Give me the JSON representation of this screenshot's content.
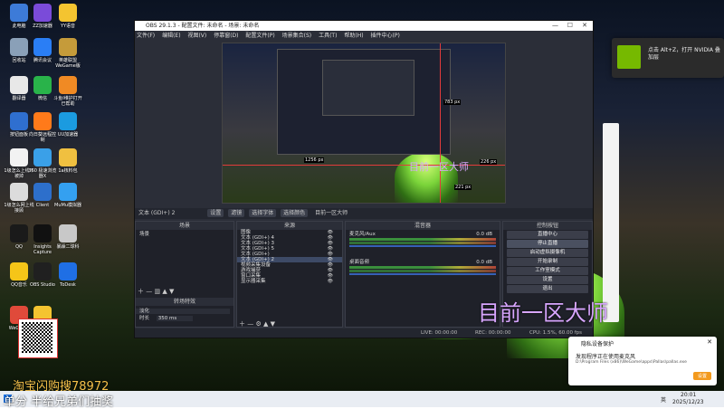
{
  "desktop_icons": [
    {
      "label": "此电脑",
      "color": "#3d7bd8"
    },
    {
      "label": "ZZ加速器",
      "color": "#7a4bd9"
    },
    {
      "label": "YY语音",
      "color": "#f4c430"
    },
    {
      "label": "回收站",
      "color": "#8aa0b8"
    },
    {
      "label": "腾讯会议",
      "color": "#2a7ef5"
    },
    {
      "label": "英雄联盟WeGame版",
      "color": "#c59b3a"
    },
    {
      "label": "翻译器",
      "color": "#e8e8e8"
    },
    {
      "label": "微信",
      "color": "#29b34a"
    },
    {
      "label": "斗鱼Ⅰ维护打开已帮助",
      "color": "#f08a24"
    },
    {
      "label": "按钮面板",
      "color": "#2f6fd0"
    },
    {
      "label": "向日葵远程控制",
      "color": "#ff7a1a"
    },
    {
      "label": "UU加速器",
      "color": "#1b9be0"
    },
    {
      "label": "1级怎么上线不被掉",
      "color": "#f2f2f2"
    },
    {
      "label": "360 极速浏览器X",
      "color": "#3aa0e8"
    },
    {
      "label": "1a核料包",
      "color": "#f0c040"
    },
    {
      "label": "1级怎么网上线接顾",
      "color": "#dcdcdc"
    },
    {
      "label": "Client",
      "color": "#2d6fcb"
    },
    {
      "label": "MuMu模拟器",
      "color": "#34a0f0"
    },
    {
      "label": "QQ",
      "color": "#1a1a1a"
    },
    {
      "label": "Insights Capture",
      "color": "#111111"
    },
    {
      "label": "暴躁二球科",
      "color": "#c8c8c8"
    },
    {
      "label": "QQ音乐",
      "color": "#f5c518"
    },
    {
      "label": "OBS Studio",
      "color": "#202020"
    },
    {
      "label": "ToDesk",
      "color": "#1f6fe5"
    },
    {
      "label": "WeGame",
      "color": "#e04a3a"
    },
    {
      "label": "YY开播",
      "color": "#f4c430"
    }
  ],
  "obs": {
    "title": "OBS 29.1.3 - 配置文件: 未命名 - 场景: 未命名",
    "menu": [
      "文件(F)",
      "编辑(E)",
      "视图(V)",
      "停靠窗(D)",
      "配置文件(P)",
      "场景集合(S)",
      "工具(T)",
      "帮助(H)",
      "插件中心(P)"
    ],
    "preview_labels": {
      "w_px": "1256 px",
      "h_px": "783 px",
      "r_px": "226 px",
      "b_px": "221 px",
      "overlay": "目前一区大师"
    },
    "source_bar": {
      "selected": "文本 (GDI+) 2",
      "buttons": [
        "设置",
        "滤镜",
        "选择字体",
        "选择颜色"
      ],
      "text": "目前一区大师"
    },
    "scenes": {
      "title": "场景",
      "items": [
        "场景"
      ]
    },
    "sources": {
      "title": "来源",
      "items": [
        "图像",
        "文本 (GDI+) 4",
        "文本 (GDI+) 3",
        "文本 (GDI+) 5",
        "文本 (GDI+)",
        "文本 (GDI+) 2",
        "视频采集设备",
        "游戏捕获",
        "窗口采集",
        "显示器采集"
      ],
      "selected": "文本 (GDI+) 2"
    },
    "mixer": {
      "title": "混音器",
      "channels": [
        {
          "name": "麦克风/Aux",
          "db": "0.0 dB"
        },
        {
          "name": "桌面音频",
          "db": "0.0 dB"
        }
      ],
      "ticks": [
        "-60",
        "-55",
        "-50",
        "-45",
        "-40",
        "-35",
        "-30",
        "-25",
        "-20",
        "-15",
        "-10",
        "-5",
        "0"
      ]
    },
    "transitions": {
      "title": "转场特效",
      "type": "淡化",
      "duration_label": "时长",
      "duration": "350 ms"
    },
    "controls": {
      "title": "控制按钮",
      "buttons": [
        "直播中心",
        "停止直播",
        "启动虚拟摄像机",
        "开始录制",
        "工作室模式",
        "设置",
        "退出"
      ]
    },
    "status": {
      "live": "LIVE: 00:00:00",
      "rec": "REC: 00:00:00",
      "cpu": "CPU: 1.5%, 60.00 fps"
    }
  },
  "overlay_text": {
    "big": "目前一区大师",
    "bottom1": "淘宝闪购搜78972",
    "bottom2": "单分 半给兄弟们抽奖"
  },
  "nvidia": {
    "text": "点击 Alt+Z，打开 NVIDIA 叠加层"
  },
  "privacy_popup": {
    "title": "隐私设备保护",
    "body": "发现程序正在使用麦克风",
    "path": "D:\\Program Files (x86)\\WeGame\\apps\\Pallas\\pallas.exe",
    "button": "设置"
  },
  "taskbar": {
    "time": "20:01",
    "date": "2025/12/23",
    "lang": "英"
  }
}
